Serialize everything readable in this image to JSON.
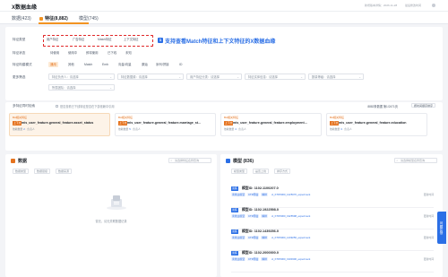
{
  "page": {
    "title": "X数据血缘",
    "meta": [
      "新增版本详情：2026-11-28",
      "最后修改时间"
    ]
  },
  "tabs": [
    {
      "label": "数据(423)"
    },
    {
      "label": "特征(8,882)"
    },
    {
      "label": "模型(745)"
    }
  ],
  "filters": {
    "feature_type_label": "特征类型",
    "feature_types": [
      "用户特征",
      "广告特征",
      "Match特征",
      "上下文特征"
    ],
    "annotation": "支持查看Match特征和上下文特征的X数据血缘",
    "feature_status_label": "特征状态",
    "feature_status": [
      "待使用",
      "使用中",
      "即将使用",
      "已下线",
      "未知"
    ],
    "feature_category_label": "特征构建模式",
    "feature_categories": [
      "通用",
      "其他",
      "Match",
      "Emb",
      "向量/向量",
      "原始",
      "序列/拼接",
      "ID"
    ],
    "more_label": "更多筛选",
    "more_selects": [
      "特征负责人：请选择",
      "特征数据源：请选择",
      "用户特征分类：请选择",
      "特征实体信息：请选择",
      "数量等级：请选择"
    ],
    "group_select": "所属团队：请选择"
  },
  "scroll": {
    "title": "多特征同时检索",
    "hint": "是否查看已下线特征是否在下游依赖中引用",
    "count": "8882条数据 第1/2471页",
    "sort": "按时间顺序排序"
  },
  "cards": [
    {
      "tag": "BA相关特征",
      "badge": "上下文",
      "name": "mis_user_feature.general_feature.asset_status",
      "meta_label": "依赖数量",
      "meta_value": "2",
      "meta_owner": "负责人"
    },
    {
      "tag": "BA相关特征",
      "badge": "上下文",
      "name": "mis_user_feature.general_feature.marriage_st...",
      "meta_label": "依赖数量",
      "meta_value": "5",
      "meta_owner": "负责人"
    },
    {
      "tag": "BA相关特征",
      "badge": "上下文",
      "name": "mis_user_feature.general_feature.employment...",
      "meta_label": "依赖数量",
      "meta_value": "4",
      "meta_owner": "负责人"
    },
    {
      "tag": "BA相关特征",
      "badge": "上下文",
      "name": "mis_user_feature.general_feature.education",
      "meta_label": "依赖数量",
      "meta_value": "3",
      "meta_owner": "负责人"
    }
  ],
  "data_panel": {
    "title": "数据",
    "search": "请选择特征名称查询",
    "selects": [
      "数据类型",
      "数据层级",
      "数据来源"
    ],
    "empty": "暂无，请无关联数据记录"
  },
  "model_panel": {
    "title": "模型 (836)",
    "search": "请选择模型名称查询",
    "selects": [
      "模型类型",
      "是否上线",
      "排序方式"
    ],
    "items": [
      {
        "badge": "训练",
        "title": "模型ID: 1102.1100207.0",
        "tags": [
          "离线主模型",
          "CTR预估",
          "精排"
        ],
        "link": "ct_KTD5000_1225070_experiment",
        "right": "更新时间"
      },
      {
        "badge": "训练",
        "title": "模型ID: 1102.1922598.0",
        "tags": [
          "离线主模型",
          "CTR预估",
          "精排"
        ],
        "link": "ct_KTD5000_1925598_experiment",
        "right": "更新时间"
      },
      {
        "badge": "训练",
        "title": "模型ID: 1102.1439256.0",
        "tags": [
          "离线主模型",
          "CTR预估",
          "精排"
        ],
        "link": "ct_KTD5000_1439256_experiment",
        "right": "更新时间"
      },
      {
        "badge": "训练",
        "title": "模型ID: 1102.2000000.0",
        "tags": [
          "离线主模型",
          "CTR预估",
          "精排"
        ],
        "link": "ct_KTD5000_1930300_experiment",
        "right": "更新时间"
      }
    ]
  },
  "side_tab": "问题反馈",
  "colors": {
    "accent": "#f29322",
    "brand": "#2b6fe6",
    "annotation": "#e0292a"
  }
}
